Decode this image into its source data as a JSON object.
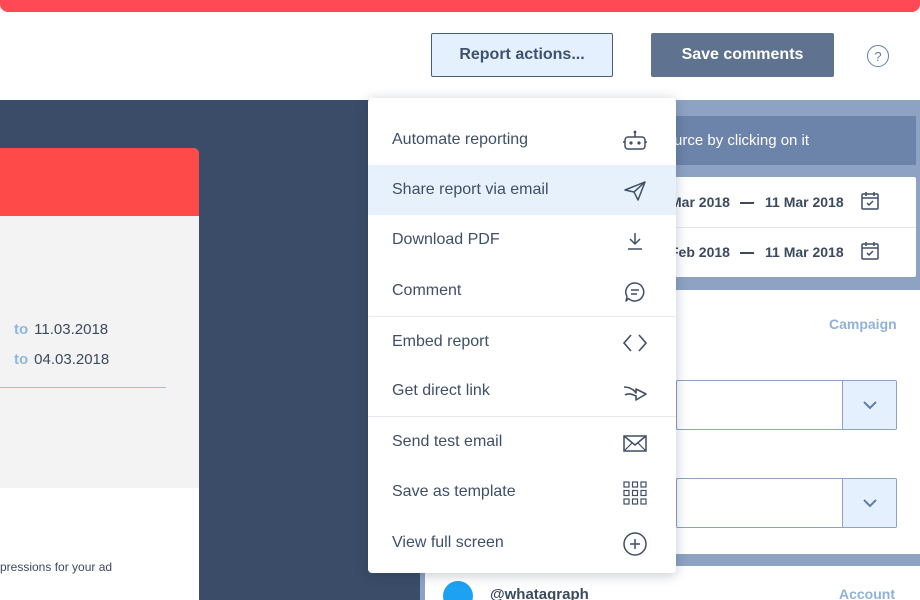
{
  "header": {
    "report_actions_label": "Report actions...",
    "save_comments_label": "Save comments",
    "help_label": "?"
  },
  "left_card": {
    "date_rows": [
      {
        "to_label": "to",
        "date": "11.03.2018"
      },
      {
        "to_label": "to",
        "date": "04.03.2018"
      }
    ],
    "impressions_text": "pressions for your ad"
  },
  "right_panel": {
    "hint_text": "urce by clicking on it",
    "date_ranges": [
      {
        "from": "Mar 2018",
        "until": "11 Mar 2018"
      },
      {
        "from": "Feb 2018",
        "until": "11 Mar 2018"
      }
    ],
    "campaign_label": "Campaign",
    "account": {
      "handle": "@whatagraph",
      "label": "Account"
    }
  },
  "dropdown": {
    "items": [
      {
        "label": "Automate reporting",
        "icon": "robot-icon"
      },
      {
        "label": "Share report via email",
        "icon": "paper-plane-icon",
        "active": true
      },
      {
        "label": "Download PDF",
        "icon": "download-icon"
      },
      {
        "label": "Comment",
        "icon": "comment-icon"
      },
      {
        "label": "Embed report",
        "icon": "code-brackets-icon"
      },
      {
        "label": "Get direct link",
        "icon": "share-arrow-icon"
      },
      {
        "label": "Send test email",
        "icon": "envelope-icon"
      },
      {
        "label": "Save as template",
        "icon": "grid-icon"
      },
      {
        "label": "View full screen",
        "icon": "plus-circle-icon"
      }
    ]
  },
  "colors": {
    "accent_red": "#ff4a55",
    "dark_navy": "#3a4c68",
    "panel_blue": "#8ea3c4",
    "active_item_bg": "#e6f1fc"
  }
}
